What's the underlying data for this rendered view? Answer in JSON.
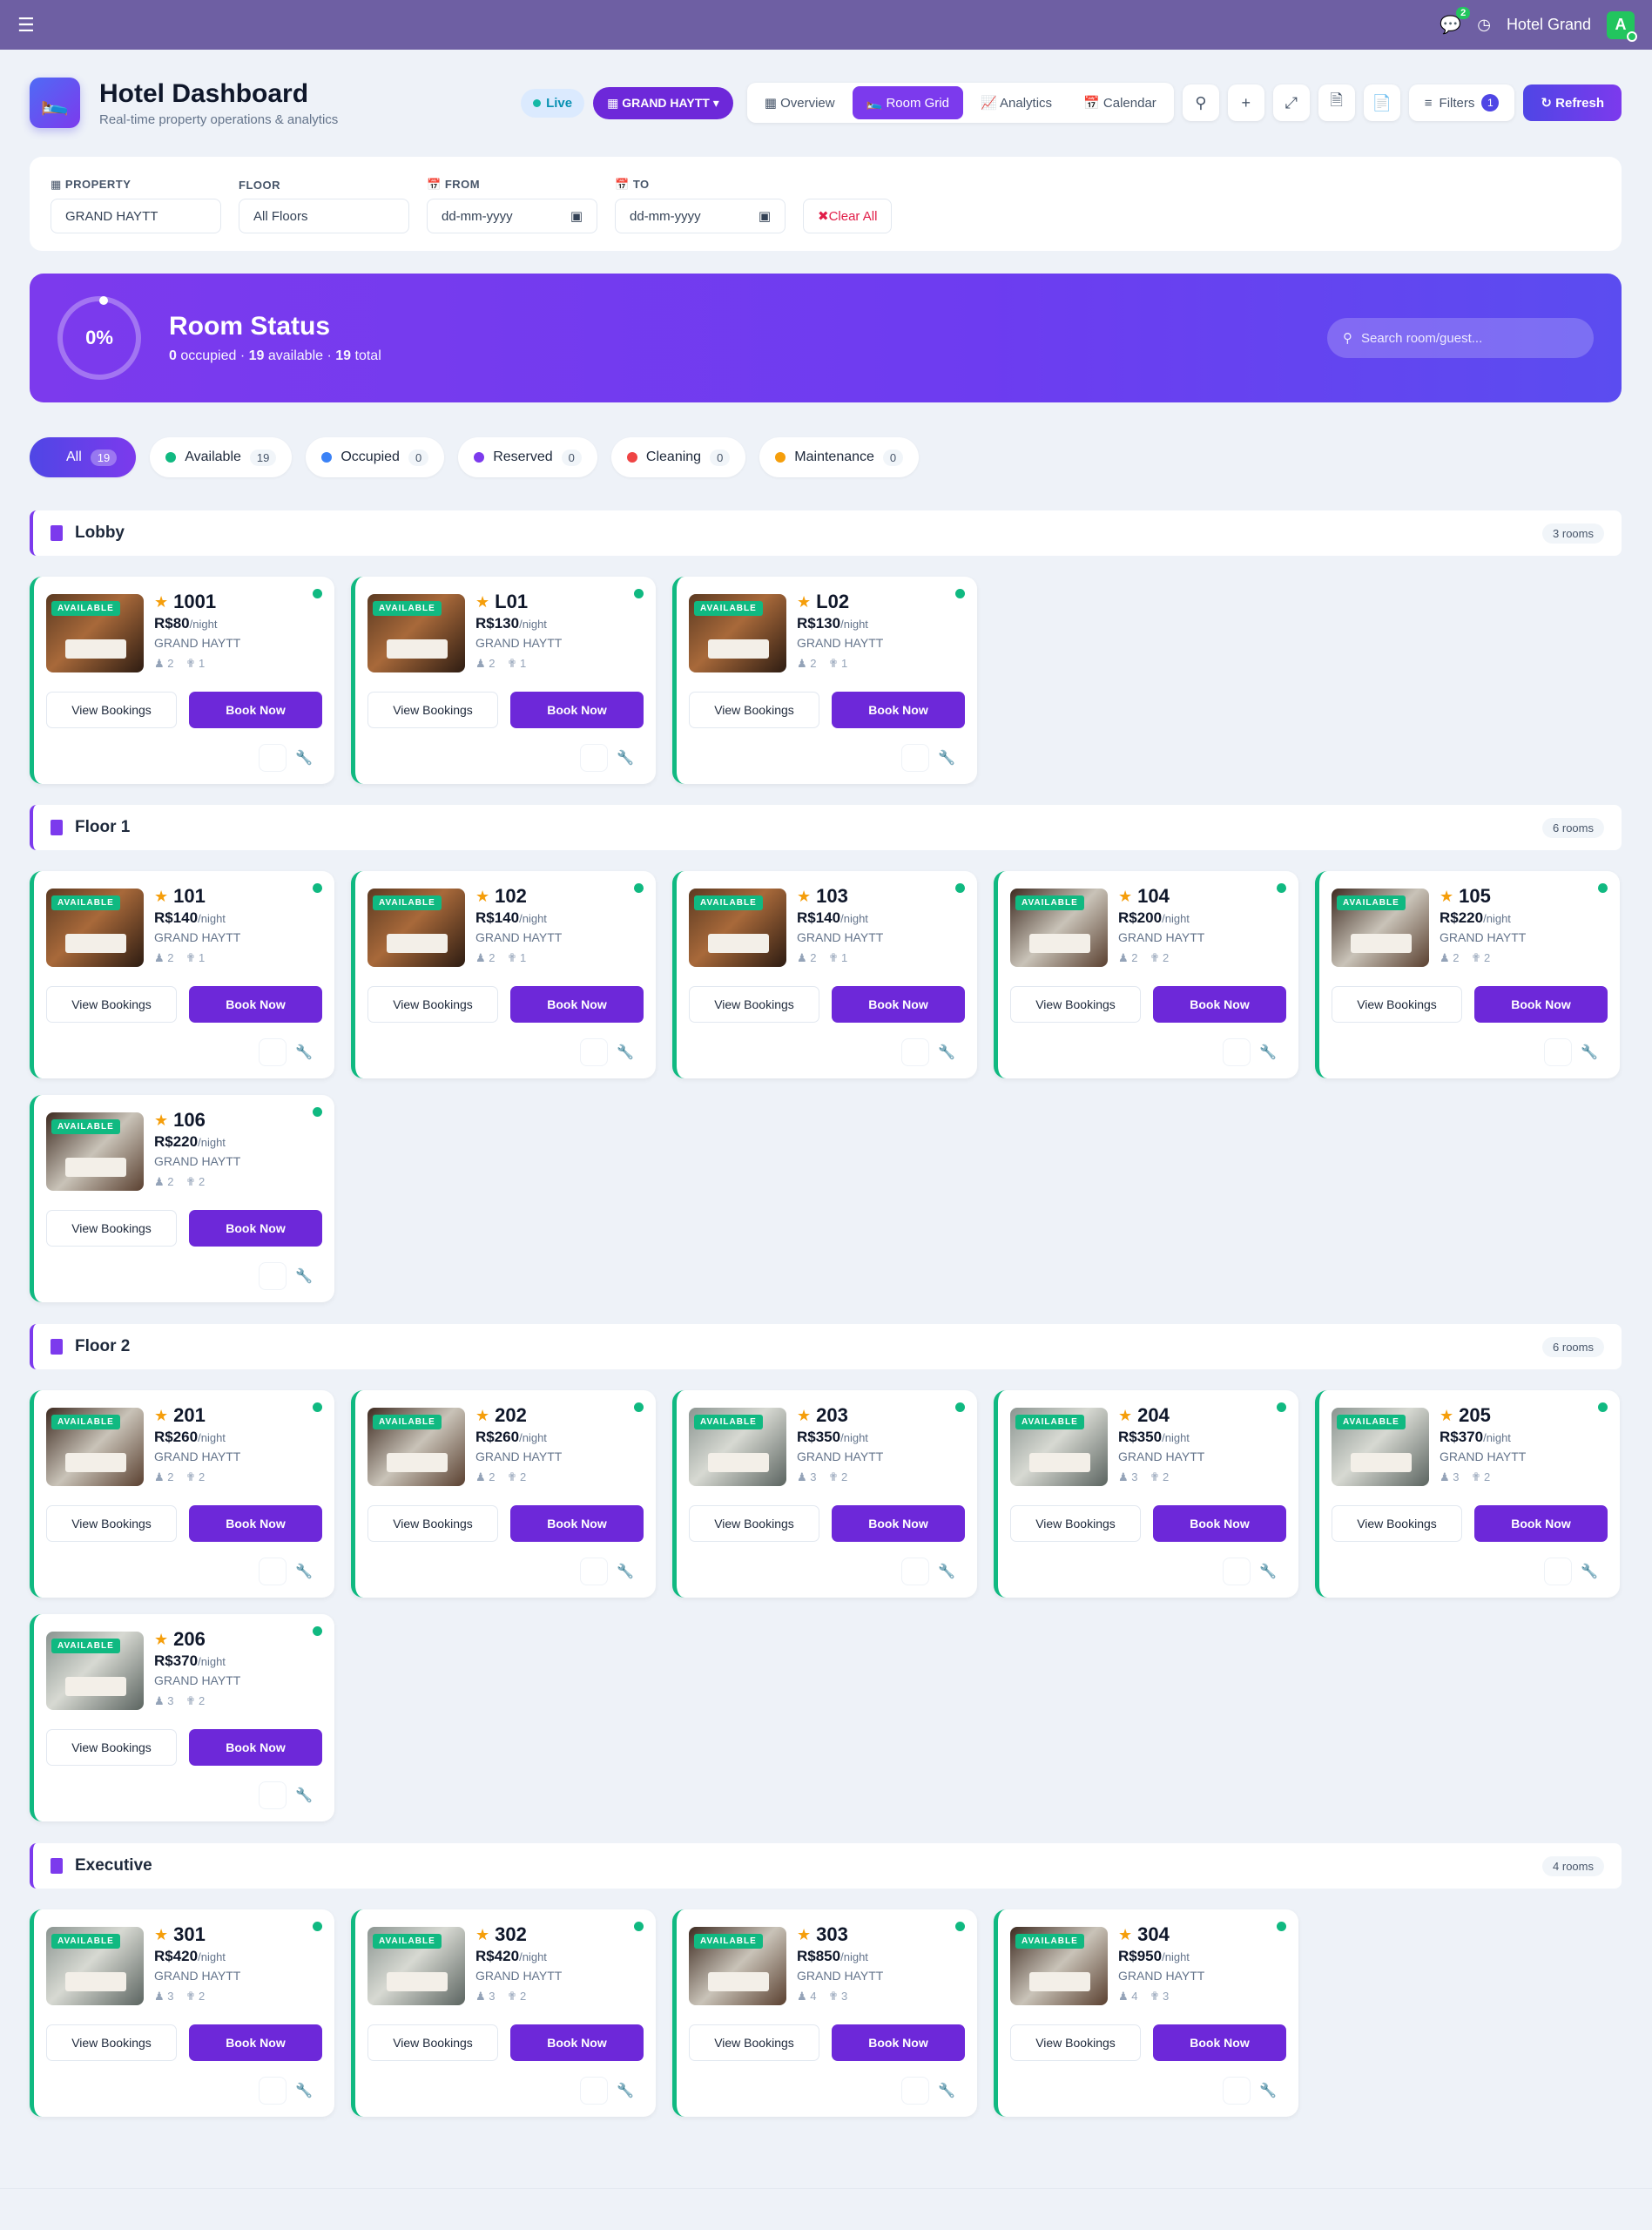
{
  "topbar": {
    "menu_icon": "hamburger-icon",
    "chat_badge": "2",
    "clock_icon": "clock-icon",
    "hotel_name": "Hotel Grand",
    "avatar_initial": "A"
  },
  "header": {
    "title": "Hotel Dashboard",
    "subtitle": "Real-time property operations & analytics",
    "live_label": "Live",
    "property_pill": "GRAND HAYTT",
    "tabs": [
      {
        "label": "Overview",
        "icon": "grid-icon"
      },
      {
        "label": "Room Grid",
        "icon": "bed-icon",
        "active": true
      },
      {
        "label": "Analytics",
        "icon": "chart-icon"
      },
      {
        "label": "Calendar",
        "icon": "calendar-icon"
      }
    ],
    "filters_label": "Filters",
    "filters_count": "1",
    "refresh_label": "Refresh"
  },
  "filters": {
    "property_label": "PROPERTY",
    "property_value": "GRAND HAYTT",
    "floor_label": "FLOOR",
    "floor_value": "All Floors",
    "from_label": "FROM",
    "from_value": "dd-mm-yyyy",
    "to_label": "TO",
    "to_value": "dd-mm-yyyy",
    "clear_label": "Clear All"
  },
  "banner": {
    "percent": "0%",
    "occupancy_fraction": 0,
    "title": "Room Status",
    "occupied": "0",
    "occupied_label": "occupied",
    "available": "19",
    "available_label": "available",
    "total": "19",
    "total_label": "total",
    "search_placeholder": "Search room/guest..."
  },
  "status_chips": [
    {
      "label": "All",
      "count": "19",
      "color": "#ffffff",
      "active": true
    },
    {
      "label": "Available",
      "count": "19",
      "color": "#10b981"
    },
    {
      "label": "Occupied",
      "count": "0",
      "color": "#3b82f6"
    },
    {
      "label": "Reserved",
      "count": "0",
      "color": "#7c3aed"
    },
    {
      "label": "Cleaning",
      "count": "0",
      "color": "#ef4444"
    },
    {
      "label": "Maintenance",
      "count": "0",
      "color": "#f59e0b"
    }
  ],
  "card_labels": {
    "badge": "AVAILABLE",
    "per_night": "/night",
    "view_bookings": "View Bookings",
    "book_now": "Book Now"
  },
  "sections": [
    {
      "name": "Lobby",
      "count_label": "3 rooms",
      "rooms": [
        {
          "number": "1001",
          "price": "R$80",
          "property": "GRAND HAYTT",
          "guests": "2",
          "beds": "1",
          "photo": "dark"
        },
        {
          "number": "L01",
          "price": "R$130",
          "property": "GRAND HAYTT",
          "guests": "2",
          "beds": "1",
          "photo": "dark"
        },
        {
          "number": "L02",
          "price": "R$130",
          "property": "GRAND HAYTT",
          "guests": "2",
          "beds": "1",
          "photo": "dark"
        }
      ]
    },
    {
      "name": "Floor 1",
      "count_label": "6 rooms",
      "rooms": [
        {
          "number": "101",
          "price": "R$140",
          "property": "GRAND HAYTT",
          "guests": "2",
          "beds": "1",
          "photo": "dark"
        },
        {
          "number": "102",
          "price": "R$140",
          "property": "GRAND HAYTT",
          "guests": "2",
          "beds": "1",
          "photo": "dark"
        },
        {
          "number": "103",
          "price": "R$140",
          "property": "GRAND HAYTT",
          "guests": "2",
          "beds": "1",
          "photo": "dark"
        },
        {
          "number": "104",
          "price": "R$200",
          "property": "GRAND HAYTT",
          "guests": "2",
          "beds": "2",
          "photo": "mix"
        },
        {
          "number": "105",
          "price": "R$220",
          "property": "GRAND HAYTT",
          "guests": "2",
          "beds": "2",
          "photo": "mix"
        },
        {
          "number": "106",
          "price": "R$220",
          "property": "GRAND HAYTT",
          "guests": "2",
          "beds": "2",
          "photo": "mix"
        }
      ]
    },
    {
      "name": "Floor 2",
      "count_label": "6 rooms",
      "rooms": [
        {
          "number": "201",
          "price": "R$260",
          "property": "GRAND HAYTT",
          "guests": "2",
          "beds": "2",
          "photo": "mix"
        },
        {
          "number": "202",
          "price": "R$260",
          "property": "GRAND HAYTT",
          "guests": "2",
          "beds": "2",
          "photo": "mix"
        },
        {
          "number": "203",
          "price": "R$350",
          "property": "GRAND HAYTT",
          "guests": "3",
          "beds": "2",
          "photo": "light"
        },
        {
          "number": "204",
          "price": "R$350",
          "property": "GRAND HAYTT",
          "guests": "3",
          "beds": "2",
          "photo": "light"
        },
        {
          "number": "205",
          "price": "R$370",
          "property": "GRAND HAYTT",
          "guests": "3",
          "beds": "2",
          "photo": "light"
        },
        {
          "number": "206",
          "price": "R$370",
          "property": "GRAND HAYTT",
          "guests": "3",
          "beds": "2",
          "photo": "light"
        }
      ]
    },
    {
      "name": "Executive",
      "count_label": "4 rooms",
      "rooms": [
        {
          "number": "301",
          "price": "R$420",
          "property": "GRAND HAYTT",
          "guests": "3",
          "beds": "2",
          "photo": "light"
        },
        {
          "number": "302",
          "price": "R$420",
          "property": "GRAND HAYTT",
          "guests": "3",
          "beds": "2",
          "photo": "light"
        },
        {
          "number": "303",
          "price": "R$850",
          "property": "GRAND HAYTT",
          "guests": "4",
          "beds": "3",
          "photo": "mix"
        },
        {
          "number": "304",
          "price": "R$950",
          "property": "GRAND HAYTT",
          "guests": "4",
          "beds": "3",
          "photo": "mix"
        }
      ]
    }
  ]
}
